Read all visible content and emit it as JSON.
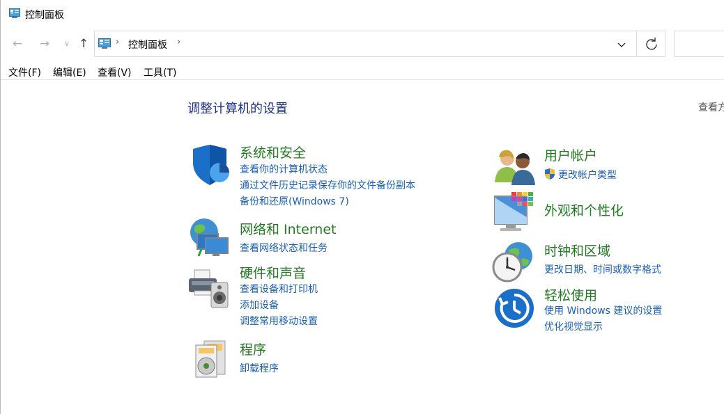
{
  "window": {
    "title": "控制面板"
  },
  "nav": {
    "back_icon": "back-arrow-icon",
    "forward_icon": "forward-arrow-icon",
    "recent_icon": "chevron-down-icon",
    "up_icon": "up-arrow-icon",
    "breadcrumb": "控制面板",
    "breadcrumb_sep": "›",
    "dropdown_icon": "chevron-down-icon",
    "refresh_icon": "refresh-icon",
    "search_placeholder": ""
  },
  "menu": {
    "file": "文件(F)",
    "edit": "编辑(E)",
    "view": "查看(V)",
    "tools": "工具(T)"
  },
  "main": {
    "heading": "调整计算机的设置",
    "view_by": "查看方"
  },
  "categories_left": [
    {
      "title": "系统和安全",
      "icon": "shield-icon",
      "links": [
        "查看你的计算机状态",
        "通过文件历史记录保存你的文件备份副本",
        "备份和还原(Windows 7)"
      ]
    },
    {
      "title": "网络和 Internet",
      "icon": "network-icon",
      "links": [
        "查看网络状态和任务"
      ]
    },
    {
      "title": "硬件和声音",
      "icon": "printer-speaker-icon",
      "links": [
        "查看设备和打印机",
        "添加设备",
        "调整常用移动设置"
      ]
    },
    {
      "title": "程序",
      "icon": "programs-icon",
      "links": [
        "卸载程序"
      ]
    }
  ],
  "categories_right": [
    {
      "title": "用户帐户",
      "icon": "users-icon",
      "links": [
        "更改帐户类型"
      ]
    },
    {
      "title": "外观和个性化",
      "icon": "monitor-palette-icon",
      "links": []
    },
    {
      "title": "时钟和区域",
      "icon": "clock-globe-icon",
      "links": [
        "更改日期、时间或数字格式"
      ]
    },
    {
      "title": "轻松使用",
      "icon": "ease-of-access-icon",
      "links": [
        "使用 Windows 建议的设置",
        "优化视觉显示"
      ]
    }
  ],
  "colors": {
    "heading": "#1e3287",
    "category_title": "#237a22",
    "link": "#1a5fb4"
  }
}
